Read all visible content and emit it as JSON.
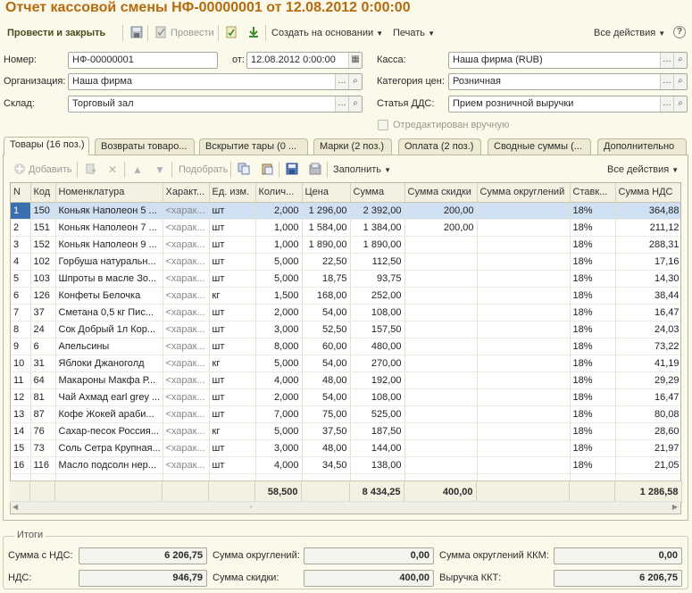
{
  "window": {
    "title": "Отчет кассовой смены НФ-00000001 от 12.08.2012 0:00:00"
  },
  "toolbar": {
    "post_and_close": "Провести и закрыть",
    "post": "Провести",
    "create_based_on": "Создать на основании",
    "print": "Печать",
    "all_actions": "Все действия"
  },
  "header": {
    "number_label": "Номер:",
    "number_value": "НФ-00000001",
    "from_label": "от:",
    "date_value": "12.08.2012  0:00:00",
    "kassa_label": "Касса:",
    "kassa_value": "Наша фирма (RUB)",
    "org_label": "Организация:",
    "org_value": "Наша фирма",
    "price_cat_label": "Категория цен:",
    "price_cat_value": "Розничная",
    "warehouse_label": "Склад:",
    "warehouse_value": "Торговый зал",
    "dds_label": "Статья ДДС:",
    "dds_value": "Прием розничной выручки",
    "edited_label": "Отредактирован вручную"
  },
  "tabs": [
    {
      "label": "Товары (16 поз.)"
    },
    {
      "label": "Возвраты товаро..."
    },
    {
      "label": "Вскрытие тары (0 ..."
    },
    {
      "label": "Марки (2 поз.)"
    },
    {
      "label": "Оплата (2 поз.)"
    },
    {
      "label": "Сводные суммы (..."
    },
    {
      "label": "Дополнительно"
    }
  ],
  "table_toolbar": {
    "add": "Добавить",
    "select": "Подобрать",
    "fill": "Заполнить",
    "all_actions": "Все действия"
  },
  "table": {
    "columns": [
      "N",
      "Код",
      "Номенклатура",
      "Характ...",
      "Ед. изм.",
      "Колич...",
      "Цена",
      "Сумма",
      "Сумма скидки",
      "Сумма округлений",
      "Ставк...",
      "Сумма НДС"
    ],
    "rows": [
      [
        "1",
        "150",
        "Коньяк Наполеон 5 ...",
        "<харак...",
        "шт",
        "2,000",
        "1 296,00",
        "2 392,00",
        "200,00",
        "",
        "18%",
        "364,88"
      ],
      [
        "2",
        "151",
        "Коньяк Наполеон 7 ...",
        "<харак...",
        "шт",
        "1,000",
        "1 584,00",
        "1 384,00",
        "200,00",
        "",
        "18%",
        "211,12"
      ],
      [
        "3",
        "152",
        "Коньяк Наполеон 9 ...",
        "<харак...",
        "шт",
        "1,000",
        "1 890,00",
        "1 890,00",
        "",
        "",
        "18%",
        "288,31"
      ],
      [
        "4",
        "102",
        "Горбуша натуральн...",
        "<харак...",
        "шт",
        "5,000",
        "22,50",
        "112,50",
        "",
        "",
        "18%",
        "17,16"
      ],
      [
        "5",
        "103",
        "Шпроты в масле Зо...",
        "<харак...",
        "шт",
        "5,000",
        "18,75",
        "93,75",
        "",
        "",
        "18%",
        "14,30"
      ],
      [
        "6",
        "126",
        "Конфеты Белочка",
        "<харак...",
        "кг",
        "1,500",
        "168,00",
        "252,00",
        "",
        "",
        "18%",
        "38,44"
      ],
      [
        "7",
        "37",
        "Сметана 0,5 кг  Пис...",
        "<харак...",
        "шт",
        "2,000",
        "54,00",
        "108,00",
        "",
        "",
        "18%",
        "16,47"
      ],
      [
        "8",
        "24",
        "Сок Добрый 1л Кор...",
        "<харак...",
        "шт",
        "3,000",
        "52,50",
        "157,50",
        "",
        "",
        "18%",
        "24,03"
      ],
      [
        "9",
        "6",
        "Апельсины",
        "<харак...",
        "шт",
        "8,000",
        "60,00",
        "480,00",
        "",
        "",
        "18%",
        "73,22"
      ],
      [
        "10",
        "31",
        "Яблоки Джаноголд",
        "<харак...",
        "кг",
        "5,000",
        "54,00",
        "270,00",
        "",
        "",
        "18%",
        "41,19"
      ],
      [
        "11",
        "64",
        "Макароны Макфа Р...",
        "<харак...",
        "шт",
        "4,000",
        "48,00",
        "192,00",
        "",
        "",
        "18%",
        "29,29"
      ],
      [
        "12",
        "81",
        "Чай Ахмад earl grey ...",
        "<харак...",
        "шт",
        "2,000",
        "54,00",
        "108,00",
        "",
        "",
        "18%",
        "16,47"
      ],
      [
        "13",
        "87",
        "Кофе Жокей араби...",
        "<харак...",
        "шт",
        "7,000",
        "75,00",
        "525,00",
        "",
        "",
        "18%",
        "80,08"
      ],
      [
        "14",
        "76",
        "Сахар-песок Россия...",
        "<харак...",
        "кг",
        "5,000",
        "37,50",
        "187,50",
        "",
        "",
        "18%",
        "28,60"
      ],
      [
        "15",
        "73",
        "Соль Сетра Крупная...",
        "<харак...",
        "шт",
        "3,000",
        "48,00",
        "144,00",
        "",
        "",
        "18%",
        "21,97"
      ],
      [
        "16",
        "116",
        "Масло подсолн нер...",
        "<харак...",
        "шт",
        "4,000",
        "34,50",
        "138,00",
        "",
        "",
        "18%",
        "21,05"
      ]
    ],
    "footer": {
      "qty": "58,500",
      "sum": "8 434,25",
      "discount": "400,00",
      "vat": "1 286,58"
    }
  },
  "totals": {
    "title": "Итоги",
    "sum_with_vat_label": "Сумма с НДС:",
    "sum_with_vat": "6 206,75",
    "rounding_label": "Сумма округлений:",
    "rounding": "0,00",
    "rounding_kkm_label": "Сумма округлений ККМ:",
    "rounding_kkm": "0,00",
    "vat_label": "НДС:",
    "vat": "946,79",
    "discount_label": "Сумма скидки:",
    "discount": "400,00",
    "revenue_label": "Выручка ККТ:",
    "revenue": "6 206,75"
  }
}
